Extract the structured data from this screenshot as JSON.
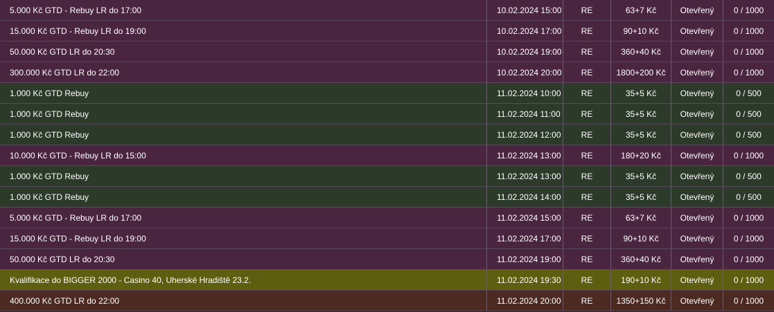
{
  "tournaments": [
    {
      "name": "5.000 Kč GTD - Rebuy LR do 17:00",
      "datetime": "10.02.2024 15:00",
      "type": "RE",
      "buyin": "63+7 Kč",
      "status": "Otevřený",
      "players": "0 / 1000",
      "row_color": "#4a2540"
    },
    {
      "name": "15.000 Kč GTD - Rebuy LR do 19:00",
      "datetime": "10.02.2024 17:00",
      "type": "RE",
      "buyin": "90+10 Kč",
      "status": "Otevřený",
      "players": "0 / 1000",
      "row_color": "#4a2540"
    },
    {
      "name": "50.000 Kč GTD LR do 20:30",
      "datetime": "10.02.2024 19:00",
      "type": "RE",
      "buyin": "360+40 Kč",
      "status": "Otevřený",
      "players": "0 / 1000",
      "row_color": "#4a2540"
    },
    {
      "name": "300.000 Kč GTD LR do 22:00",
      "datetime": "10.02.2024 20:00",
      "type": "RE",
      "buyin": "1800+200 Kč",
      "status": "Otevřený",
      "players": "0 / 1000",
      "row_color": "#4a2540"
    },
    {
      "name": "1.000 Kč GTD Rebuy",
      "datetime": "11.02.2024 10:00",
      "type": "RE",
      "buyin": "35+5 Kč",
      "status": "Otevřený",
      "players": "0 / 500",
      "row_color": "#2c3a2a"
    },
    {
      "name": "1.000 Kč GTD Rebuy",
      "datetime": "11.02.2024 11:00",
      "type": "RE",
      "buyin": "35+5 Kč",
      "status": "Otevřený",
      "players": "0 / 500",
      "row_color": "#2c3a2a"
    },
    {
      "name": "1.000 Kč GTD Rebuy",
      "datetime": "11.02.2024 12:00",
      "type": "RE",
      "buyin": "35+5 Kč",
      "status": "Otevřený",
      "players": "0 / 500",
      "row_color": "#2c3a2a"
    },
    {
      "name": "10.000 Kč GTD - Rebuy LR do 15:00",
      "datetime": "11.02.2024 13:00",
      "type": "RE",
      "buyin": "180+20 Kč",
      "status": "Otevřený",
      "players": "0 / 1000",
      "row_color": "#4a2540"
    },
    {
      "name": "1.000 Kč GTD Rebuy",
      "datetime": "11.02.2024 13:00",
      "type": "RE",
      "buyin": "35+5 Kč",
      "status": "Otevřený",
      "players": "0 / 500",
      "row_color": "#2c3a2a"
    },
    {
      "name": "1.000 Kč GTD Rebuy",
      "datetime": "11.02.2024 14:00",
      "type": "RE",
      "buyin": "35+5 Kč",
      "status": "Otevřený",
      "players": "0 / 500",
      "row_color": "#2c3a2a"
    },
    {
      "name": "5.000 Kč GTD - Rebuy LR do 17:00",
      "datetime": "11.02.2024 15:00",
      "type": "RE",
      "buyin": "63+7 Kč",
      "status": "Otevřený",
      "players": "0 / 1000",
      "row_color": "#4a2540"
    },
    {
      "name": "15.000 Kč GTD - Rebuy LR do 19:00",
      "datetime": "11.02.2024 17:00",
      "type": "RE",
      "buyin": "90+10 Kč",
      "status": "Otevřený",
      "players": "0 / 1000",
      "row_color": "#4a2540"
    },
    {
      "name": "50.000 Kč GTD LR do 20:30",
      "datetime": "11.02.2024 19:00",
      "type": "RE",
      "buyin": "360+40 Kč",
      "status": "Otevřený",
      "players": "0 / 1000",
      "row_color": "#4a2540"
    },
    {
      "name": "Kvalifikace do BIGGER 2000 - Casino 40, Uherské Hradiště 23.2.",
      "datetime": "11.02.2024 19:30",
      "type": "RE",
      "buyin": "190+10 Kč",
      "status": "Otevřený",
      "players": "0 / 1000",
      "row_color": "#5e5e10"
    },
    {
      "name": "400.000 Kč GTD LR do 22:00",
      "datetime": "11.02.2024 20:00",
      "type": "RE",
      "buyin": "1350+150 Kč",
      "status": "Otevřený",
      "players": "0 / 1000",
      "row_color": "#4c2a22"
    }
  ]
}
